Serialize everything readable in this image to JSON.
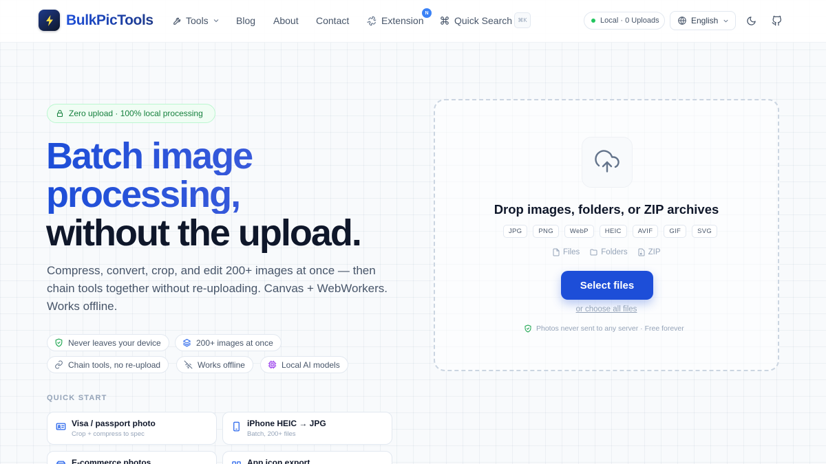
{
  "header": {
    "brand": "BulkPicTools",
    "nav": {
      "tools": "Tools",
      "blog": "Blog",
      "about": "About",
      "contact": "Contact",
      "extension": "Extension",
      "extension_badge": "N",
      "quick_search": "Quick Search",
      "quick_search_shortcut": "⌘K"
    },
    "status": "Local · 0 Uploads",
    "language": "English",
    "icons": [
      "tools-icon",
      "chevron-down-icon",
      "puzzle-icon",
      "command-icon",
      "globe-icon",
      "moon-icon",
      "github-icon"
    ]
  },
  "hero": {
    "badge": "Zero upload · 100% local processing",
    "title_line1": "Batch image",
    "title_line2": "processing,",
    "title_line3": "without the upload.",
    "subtitle": "Compress, convert, crop, and edit 200+ images at once — then chain tools together without re-uploading. Canvas + WebWorkers. Works offline.",
    "features": [
      "Never leaves your device",
      "200+ images at once",
      "Chain tools, no re-upload",
      "Works offline",
      "Local AI models"
    ]
  },
  "quick_start": {
    "label": "QUICK START",
    "cards": [
      {
        "title": "Visa / passport photo",
        "desc": "Crop + compress to spec"
      },
      {
        "title": "iPhone HEIC → JPG",
        "desc": "Batch, 200+ files"
      },
      {
        "title": "E-commerce photos",
        "desc": ""
      },
      {
        "title": "App icon export",
        "desc": ""
      }
    ]
  },
  "dropzone": {
    "title": "Drop images, folders, or ZIP archives",
    "formats": [
      "JPG",
      "PNG",
      "WebP",
      "HEIC",
      "AVIF",
      "GIF",
      "SVG"
    ],
    "sources": [
      "Files",
      "Folders",
      "ZIP"
    ],
    "select_button": "Select files",
    "choose_all": "or choose all files",
    "privacy": "Photos never sent to any server · Free forever"
  },
  "colors": {
    "accent": "#1d4ed8",
    "success": "#15803d",
    "text": "#0f172a",
    "muted": "#94a3b8"
  }
}
